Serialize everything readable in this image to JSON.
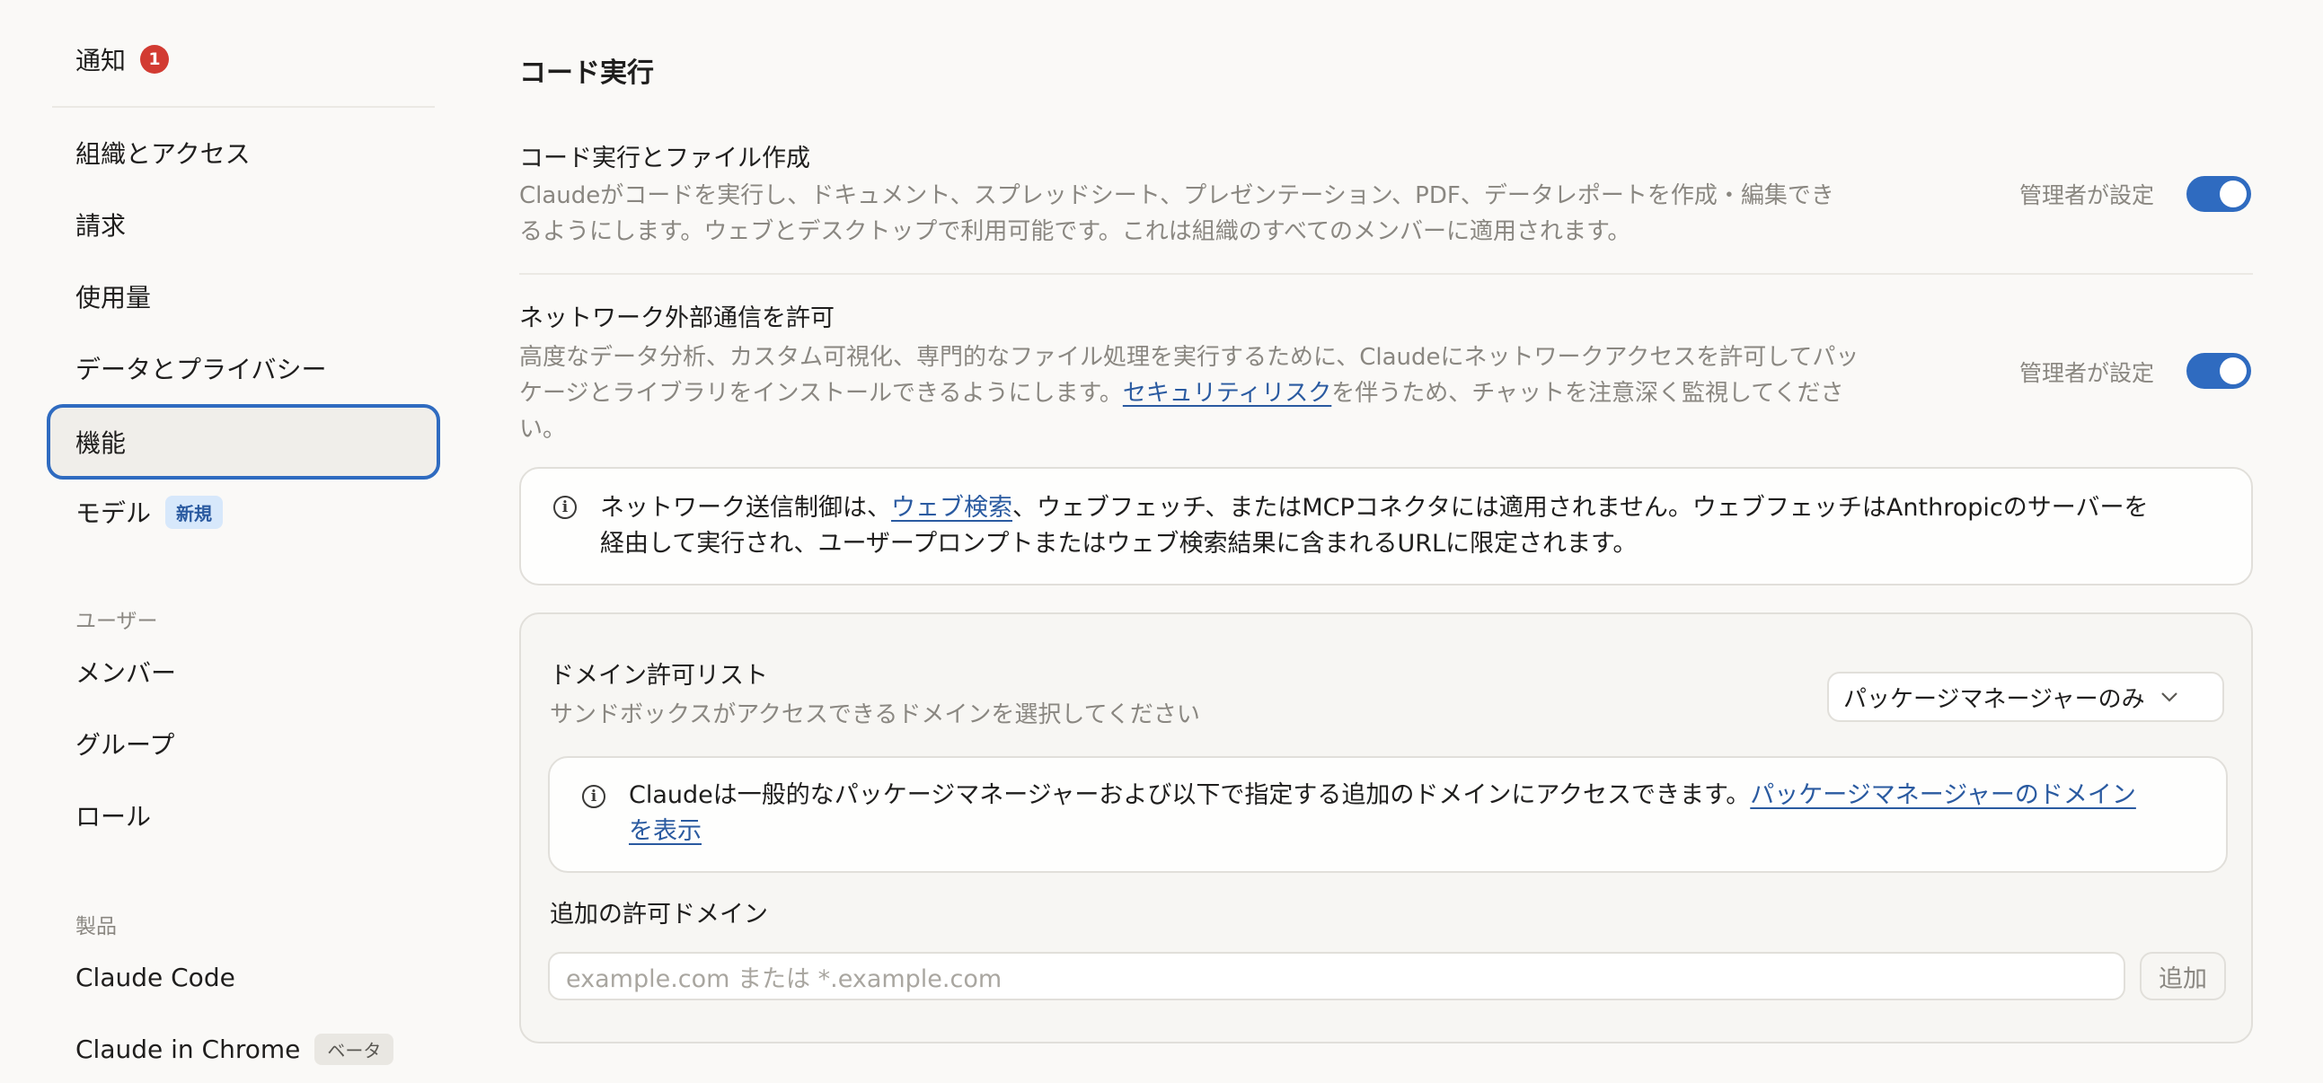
{
  "sidebar": {
    "notifications": {
      "label": "通知",
      "count": "1"
    },
    "items": [
      {
        "label": "組織とアクセス"
      },
      {
        "label": "請求"
      },
      {
        "label": "使用量"
      },
      {
        "label": "データとプライバシー"
      },
      {
        "label": "機能"
      },
      {
        "label": "モデル",
        "badge": "新規"
      }
    ],
    "users_section": {
      "label": "ユーザー",
      "items": [
        {
          "label": "メンバー"
        },
        {
          "label": "グループ"
        },
        {
          "label": "ロール"
        }
      ]
    },
    "products_section": {
      "label": "製品",
      "items": [
        {
          "label": "Claude Code"
        },
        {
          "label": "Claude in Chrome",
          "badge": "ベータ"
        }
      ]
    }
  },
  "main": {
    "title": "コード実行",
    "code_exec": {
      "title": "コード実行とファイル作成",
      "desc_line1": "Claudeがコードを実行し、ドキュメント、スプレッドシート、プレゼンテーション、PDF、データレポートを作成・編集でき",
      "desc_line2": "るようにします。ウェブとデスクトップで利用可能です。これは組織のすべてのメンバーに適用されます。",
      "admin_label": "管理者が設定",
      "enabled": true
    },
    "network": {
      "title": "ネットワーク外部通信を許可",
      "desc_line1": "高度なデータ分析、カスタム可視化、専門的なファイル処理を実行するために、Claudeにネットワークアクセスを許可してパッ",
      "desc_line2_before": "ケージとライブラリをインストールできるようにします。",
      "desc_link": "セキュリティリスク",
      "desc_line2_after": "を伴うため、チャットを注意深く監視してくださ",
      "desc_line3": "い。",
      "admin_label": "管理者が設定",
      "enabled": true
    },
    "network_info": {
      "line1_before": "ネットワーク送信制御は、",
      "line1_link": "ウェブ検索",
      "line1_after": "、ウェブフェッチ、またはMCPコネクタには適用されません。ウェブフェッチはAnthropicのサーバーを",
      "line2": "経由して実行され、ユーザープロンプトまたはウェブ検索結果に含まれるURLに限定されます。"
    },
    "domain_allowlist": {
      "title": "ドメイン許可リスト",
      "subtitle": "サンドボックスがアクセスできるドメインを選択してください",
      "select_value": "パッケージマネージャーのみ",
      "info_line1_before": "Claudeは一般的なパッケージマネージャーおよび以下で指定する追加のドメインにアクセスできます。",
      "info_line1_link": "パッケージマネージャーのドメイン",
      "info_line2_link": "を表示",
      "extra_title": "追加の許可ドメイン",
      "input_placeholder": "example.com または *.example.com",
      "add_button": "追加"
    }
  },
  "colors": {
    "accent": "#2f6bc0",
    "badge_red": "#d23b32",
    "link": "#2a5aa0"
  },
  "icons": {
    "info": "info-circle-icon",
    "chevron": "chevron-down-icon"
  }
}
